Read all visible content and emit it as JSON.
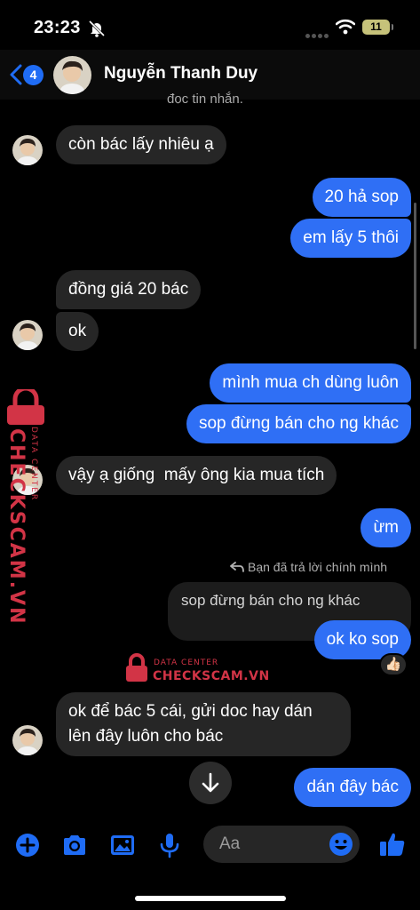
{
  "status_bar": {
    "time": "23:23",
    "battery": "11"
  },
  "header": {
    "back_count": "4",
    "contact_name": "Nguyễn Thanh Duy",
    "partial_text": "đọc tin nhắn."
  },
  "messages": [
    {
      "from": "them",
      "text": "còn bác lấy nhiêu ạ"
    },
    {
      "from": "me",
      "text": "20 hả sop"
    },
    {
      "from": "me",
      "text": "em lấy 5 thôi"
    },
    {
      "from": "them",
      "text": "đồng giá 20 bác"
    },
    {
      "from": "them",
      "text": "ok"
    },
    {
      "from": "me",
      "text": "mình mua ch dùng luôn"
    },
    {
      "from": "me",
      "text": "sop đừng bán cho ng khác"
    },
    {
      "from": "them",
      "text": "vậy ạ giống  mấy ông kia mua tích"
    },
    {
      "from": "me",
      "text": "ừm"
    },
    {
      "from": "me",
      "reply_label": "Bạn đã trả lời chính mình",
      "quoted": "sop đừng bán cho ng khác",
      "text": "ok ko sop",
      "reaction": "👍🏻"
    },
    {
      "from": "them",
      "text_lines": [
        "ok để bác 5 cái, gửi doc hay dán",
        "lên đây luôn cho bác"
      ]
    },
    {
      "from": "me",
      "text": "dán đây bác"
    }
  ],
  "watermark": {
    "brand": "CHECKSCAM.VN",
    "tag": "DATA CENTER"
  },
  "composer": {
    "placeholder": "Aa"
  },
  "icons": [
    "back-chevron-icon",
    "bell-slash-icon",
    "wifi-icon",
    "reply-arrow-icon",
    "chevron-down-icon",
    "plus-icon",
    "camera-icon",
    "image-icon",
    "microphone-icon",
    "emoji-icon",
    "thumbs-up-icon",
    "lock-icon"
  ],
  "colors": {
    "outgoing_bubble": "#2f6ff5",
    "incoming_bubble": "#262626",
    "accent": "#1f6cf5",
    "watermark": "#d23446"
  }
}
